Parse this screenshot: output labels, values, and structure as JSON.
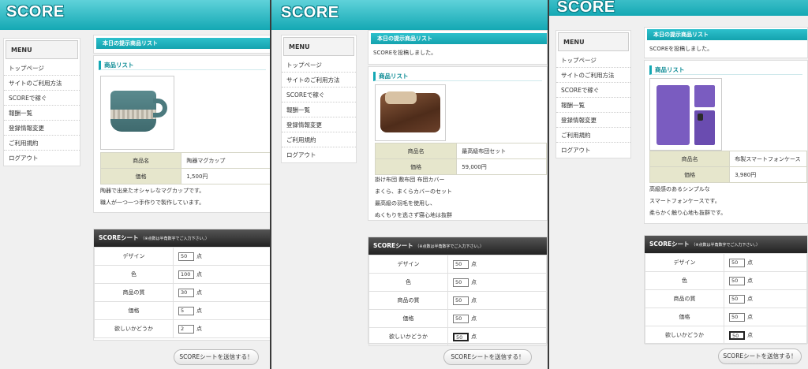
{
  "logo": "SCORE",
  "menu": {
    "title": "MENU",
    "items": [
      "トップページ",
      "サイトのご利用方法",
      "SCOREで稼ぐ",
      "報酬一覧",
      "登録情報変更",
      "ご利用規約",
      "ログアウト"
    ]
  },
  "section_title": "本日の提示商品リスト",
  "product_list_heading": "商品リスト",
  "notice": "SCOREを投稿しました。",
  "labels": {
    "name": "商品名",
    "price": "価格"
  },
  "score_sheet": {
    "title": "SCOREシート",
    "note": "（※点数は半角数字でご入力下さい。）",
    "criteria": [
      "デザイン",
      "色",
      "商品の質",
      "価格",
      "欲しいかどうか"
    ],
    "unit": "点",
    "submit": "SCOREシートを送信する！"
  },
  "panels": [
    {
      "product_name": "陶器マグカップ",
      "price": "1,500円",
      "image": "mug-photo",
      "description": [
        "陶器で出来たオシャレなマグカップです。",
        "職人が一つ一つ手作りで製作しています。"
      ],
      "scores": [
        "50",
        "100",
        "30",
        "5",
        "2"
      ]
    },
    {
      "product_name": "最高級布団セット",
      "price": "59,000円",
      "image": "duvet-photo",
      "description": [
        "掛け布団 敷布団 布団カバー",
        "まくら、まくらカバーのセット",
        "最高級の羽毛を使用し、",
        "ぬくもりを逃さず寝心地は抜群"
      ],
      "scores": [
        "50",
        "50",
        "50",
        "50",
        "50"
      ]
    },
    {
      "product_name": "布製スマートフォンケース",
      "price": "3,980円",
      "image": "phone-case-photo",
      "description": [
        "高級感のあるシンプルな",
        "スマートフォンケースです。",
        "柔らかく触り心地も抜群です。"
      ],
      "scores": [
        "50",
        "50",
        "50",
        "50",
        "50"
      ]
    }
  ]
}
